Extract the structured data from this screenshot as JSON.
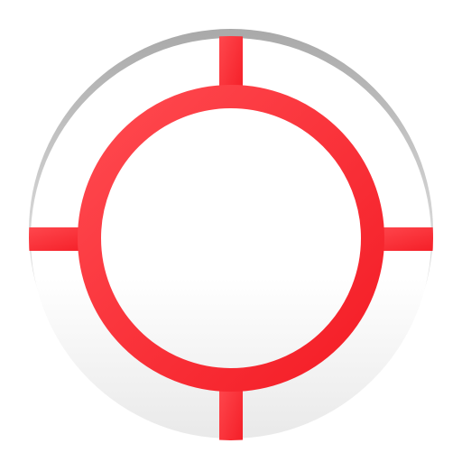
{
  "icon": {
    "name": "crosshair-target-icon",
    "colors": {
      "crosshair": "#f41c25",
      "crosshair_highlight": "#ff4a50",
      "disc_fill_top": "#ffffff",
      "disc_fill_bottom": "#e9e9e9",
      "rim_top": "#a9a9a9",
      "rim_bottom": "#dcdcdc"
    }
  }
}
